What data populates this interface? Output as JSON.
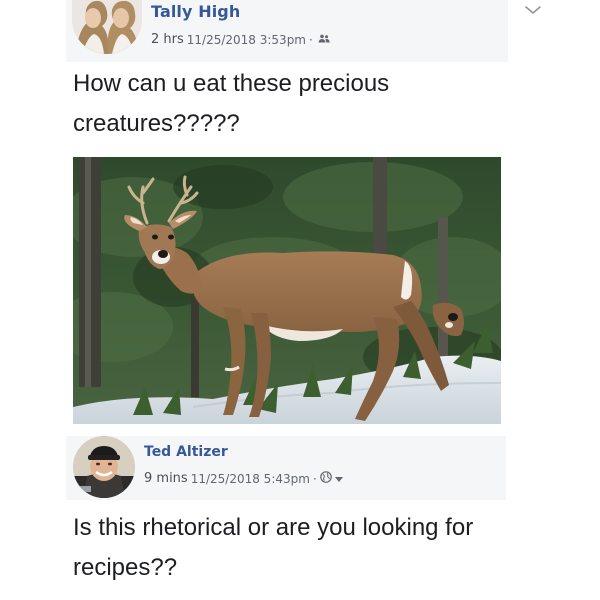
{
  "posts": [
    {
      "author": "Tally High",
      "relative_time": "2 hrs",
      "timestamp": "11/25/2018 3:53pm",
      "separator": "·",
      "audience_icon": "friends-icon",
      "text": "How can u eat these precious creatures?????"
    },
    {
      "author": "Ted Altizer",
      "relative_time": "9 mins",
      "timestamp": "11/25/2018 5:43pm",
      "separator": "·",
      "audience_icon": "globe-icon",
      "text": "Is this rhetorical or are you looking for recipes??"
    }
  ],
  "menu_icon": "chevron-down-icon",
  "colors": {
    "author_name": "#365899",
    "meta_text": "#606770",
    "header_band": "#f5f6f8",
    "post_text": "#1c1e21"
  }
}
